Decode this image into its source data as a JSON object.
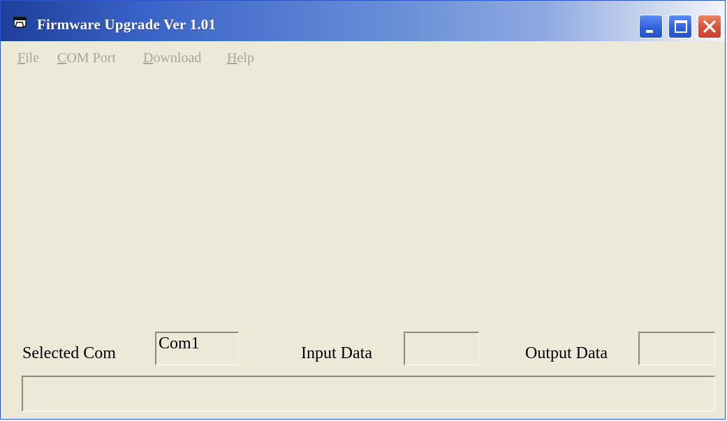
{
  "window": {
    "title": "Firmware Upgrade Ver 1.01"
  },
  "menu": {
    "items": [
      {
        "label": "File"
      },
      {
        "label": "COM Port"
      },
      {
        "label": "Download"
      },
      {
        "label": "Help"
      }
    ]
  },
  "status": {
    "selected_com_label": "Selected Com",
    "selected_com_value": "Com1",
    "input_data_label": "Input Data",
    "input_data_value": "",
    "output_data_label": "Output Data",
    "output_data_value": "",
    "progress_fraction": 0
  },
  "icons": {
    "app": "app-window-icon",
    "minimize": "minimize-icon",
    "maximize": "maximize-icon",
    "close": "close-icon"
  },
  "colors": {
    "title_bar_start": "#1e3f9a",
    "window_face": "#ece9d8",
    "menu_disabled_text": "#a8a696",
    "close_button": "#d7513a"
  }
}
